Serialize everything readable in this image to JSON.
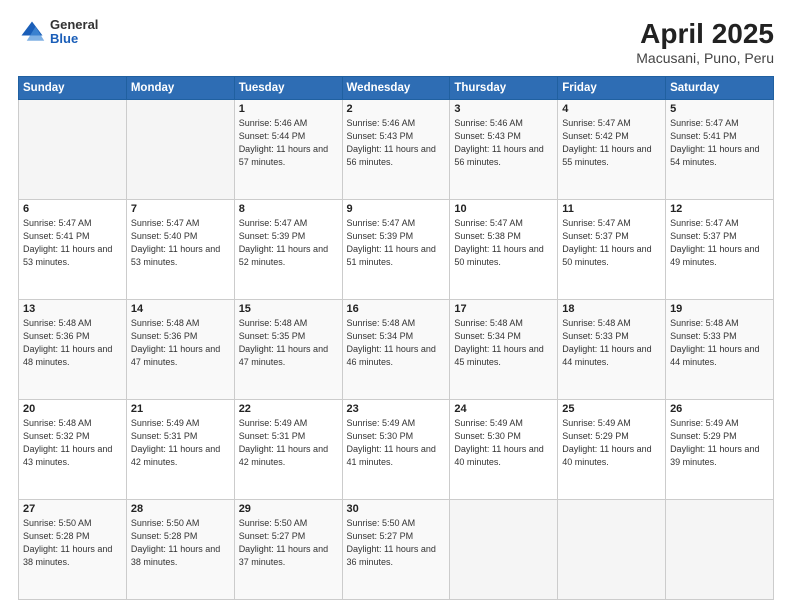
{
  "header": {
    "logo_general": "General",
    "logo_blue": "Blue",
    "title": "April 2025",
    "subtitle": "Macusani, Puno, Peru"
  },
  "days_of_week": [
    "Sunday",
    "Monday",
    "Tuesday",
    "Wednesday",
    "Thursday",
    "Friday",
    "Saturday"
  ],
  "weeks": [
    [
      {
        "date": "",
        "info": ""
      },
      {
        "date": "",
        "info": ""
      },
      {
        "date": "1",
        "info": "Sunrise: 5:46 AM\nSunset: 5:44 PM\nDaylight: 11 hours and 57 minutes."
      },
      {
        "date": "2",
        "info": "Sunrise: 5:46 AM\nSunset: 5:43 PM\nDaylight: 11 hours and 56 minutes."
      },
      {
        "date": "3",
        "info": "Sunrise: 5:46 AM\nSunset: 5:43 PM\nDaylight: 11 hours and 56 minutes."
      },
      {
        "date": "4",
        "info": "Sunrise: 5:47 AM\nSunset: 5:42 PM\nDaylight: 11 hours and 55 minutes."
      },
      {
        "date": "5",
        "info": "Sunrise: 5:47 AM\nSunset: 5:41 PM\nDaylight: 11 hours and 54 minutes."
      }
    ],
    [
      {
        "date": "6",
        "info": "Sunrise: 5:47 AM\nSunset: 5:41 PM\nDaylight: 11 hours and 53 minutes."
      },
      {
        "date": "7",
        "info": "Sunrise: 5:47 AM\nSunset: 5:40 PM\nDaylight: 11 hours and 53 minutes."
      },
      {
        "date": "8",
        "info": "Sunrise: 5:47 AM\nSunset: 5:39 PM\nDaylight: 11 hours and 52 minutes."
      },
      {
        "date": "9",
        "info": "Sunrise: 5:47 AM\nSunset: 5:39 PM\nDaylight: 11 hours and 51 minutes."
      },
      {
        "date": "10",
        "info": "Sunrise: 5:47 AM\nSunset: 5:38 PM\nDaylight: 11 hours and 50 minutes."
      },
      {
        "date": "11",
        "info": "Sunrise: 5:47 AM\nSunset: 5:37 PM\nDaylight: 11 hours and 50 minutes."
      },
      {
        "date": "12",
        "info": "Sunrise: 5:47 AM\nSunset: 5:37 PM\nDaylight: 11 hours and 49 minutes."
      }
    ],
    [
      {
        "date": "13",
        "info": "Sunrise: 5:48 AM\nSunset: 5:36 PM\nDaylight: 11 hours and 48 minutes."
      },
      {
        "date": "14",
        "info": "Sunrise: 5:48 AM\nSunset: 5:36 PM\nDaylight: 11 hours and 47 minutes."
      },
      {
        "date": "15",
        "info": "Sunrise: 5:48 AM\nSunset: 5:35 PM\nDaylight: 11 hours and 47 minutes."
      },
      {
        "date": "16",
        "info": "Sunrise: 5:48 AM\nSunset: 5:34 PM\nDaylight: 11 hours and 46 minutes."
      },
      {
        "date": "17",
        "info": "Sunrise: 5:48 AM\nSunset: 5:34 PM\nDaylight: 11 hours and 45 minutes."
      },
      {
        "date": "18",
        "info": "Sunrise: 5:48 AM\nSunset: 5:33 PM\nDaylight: 11 hours and 44 minutes."
      },
      {
        "date": "19",
        "info": "Sunrise: 5:48 AM\nSunset: 5:33 PM\nDaylight: 11 hours and 44 minutes."
      }
    ],
    [
      {
        "date": "20",
        "info": "Sunrise: 5:48 AM\nSunset: 5:32 PM\nDaylight: 11 hours and 43 minutes."
      },
      {
        "date": "21",
        "info": "Sunrise: 5:49 AM\nSunset: 5:31 PM\nDaylight: 11 hours and 42 minutes."
      },
      {
        "date": "22",
        "info": "Sunrise: 5:49 AM\nSunset: 5:31 PM\nDaylight: 11 hours and 42 minutes."
      },
      {
        "date": "23",
        "info": "Sunrise: 5:49 AM\nSunset: 5:30 PM\nDaylight: 11 hours and 41 minutes."
      },
      {
        "date": "24",
        "info": "Sunrise: 5:49 AM\nSunset: 5:30 PM\nDaylight: 11 hours and 40 minutes."
      },
      {
        "date": "25",
        "info": "Sunrise: 5:49 AM\nSunset: 5:29 PM\nDaylight: 11 hours and 40 minutes."
      },
      {
        "date": "26",
        "info": "Sunrise: 5:49 AM\nSunset: 5:29 PM\nDaylight: 11 hours and 39 minutes."
      }
    ],
    [
      {
        "date": "27",
        "info": "Sunrise: 5:50 AM\nSunset: 5:28 PM\nDaylight: 11 hours and 38 minutes."
      },
      {
        "date": "28",
        "info": "Sunrise: 5:50 AM\nSunset: 5:28 PM\nDaylight: 11 hours and 38 minutes."
      },
      {
        "date": "29",
        "info": "Sunrise: 5:50 AM\nSunset: 5:27 PM\nDaylight: 11 hours and 37 minutes."
      },
      {
        "date": "30",
        "info": "Sunrise: 5:50 AM\nSunset: 5:27 PM\nDaylight: 11 hours and 36 minutes."
      },
      {
        "date": "",
        "info": ""
      },
      {
        "date": "",
        "info": ""
      },
      {
        "date": "",
        "info": ""
      }
    ]
  ]
}
